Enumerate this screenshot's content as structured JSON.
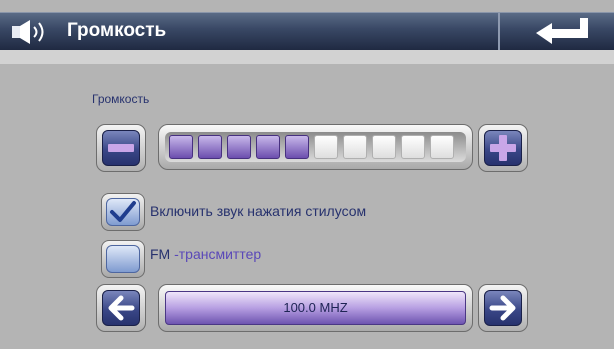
{
  "header": {
    "title": "Громкость",
    "speaker_icon": "speaker-icon",
    "back_icon": "enter-return-arrow-icon"
  },
  "volume": {
    "label": "Громкость",
    "level": 5,
    "max": 10,
    "decrease_icon": "minus-icon",
    "increase_icon": "plus-icon",
    "segment_on_color": "#7a5cbc",
    "segment_off_color": "#f2f2f2"
  },
  "options": {
    "stylus_sound": {
      "label": "Включить звук нажатия стилусом",
      "checked": true,
      "icon": "checkmark-icon"
    },
    "fm_transmitter": {
      "label_prefix": "FM",
      "label_suffix": "-трансмиттер",
      "checked": false
    }
  },
  "frequency": {
    "value": "100.0 MHZ",
    "prev_icon": "arrow-left-icon",
    "next_icon": "arrow-right-icon"
  },
  "colors": {
    "title_bar": "#2a3656",
    "panel": "#b4b4b4",
    "button_blue": "#3a4787",
    "text": "#27326e"
  }
}
